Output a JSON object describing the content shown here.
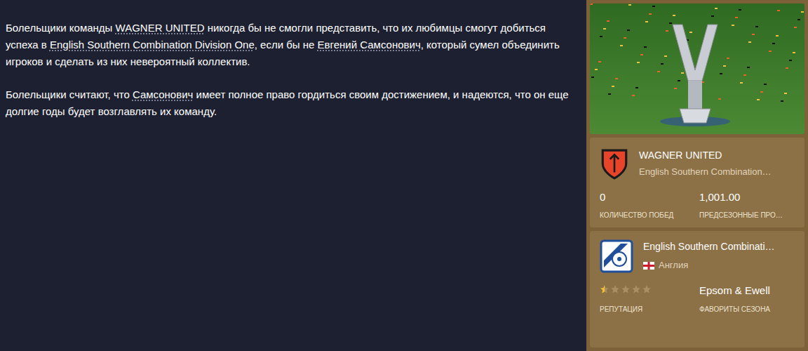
{
  "article": {
    "paragraphs": [
      [
        {
          "text": "Болельщики команды ",
          "link": false
        },
        {
          "text": "WAGNER UNITED",
          "link": true
        },
        {
          "text": " никогда бы не смогли представить, что их любимцы смогут добиться успеха в ",
          "link": false
        },
        {
          "text": "English Southern Combination Division One",
          "link": true
        },
        {
          "text": ", если бы не ",
          "link": false
        },
        {
          "text": "Евгений Самсонович",
          "link": true
        },
        {
          "text": ", который сумел объединить игроков и сделать из них невероятный коллектив.",
          "link": false
        }
      ],
      [
        {
          "text": "Болельщики считают, что ",
          "link": false
        },
        {
          "text": "Самсонович",
          "link": true
        },
        {
          "text": " имеет полное право гордиться своим достижением, и надеются, что он еще долгие годы будет возглавлять их команду.",
          "link": false
        }
      ]
    ]
  },
  "club": {
    "name": "WAGNER UNITED",
    "league": "English Southern Combination…",
    "stats": [
      {
        "value": "0",
        "label": "КОЛИЧЕСТВО ПОБЕД"
      },
      {
        "value": "1,001.00",
        "label": "ПРЕДСЕЗОННЫЕ ПРО…"
      }
    ]
  },
  "competition": {
    "name": "English Southern Combinati…",
    "country": "Англия",
    "stars": 0.5,
    "reputation_label": "РЕПУТАЦИЯ",
    "favourite": "Epsom & Ewell",
    "favourite_label": "ФАВОРИТЫ СЕЗОНА"
  }
}
